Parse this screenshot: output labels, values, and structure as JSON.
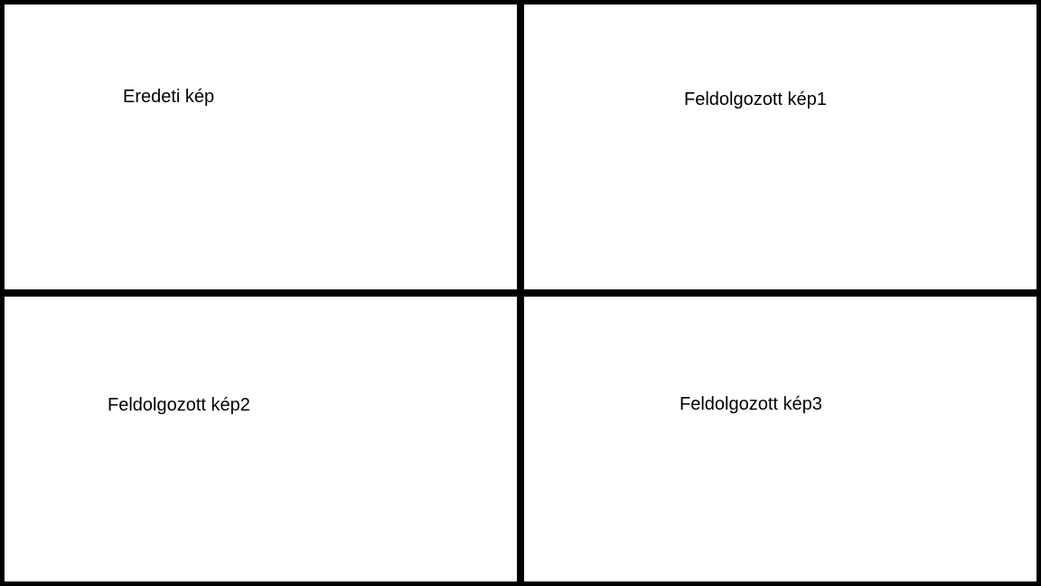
{
  "panels": {
    "original": {
      "label": "Eredeti kép"
    },
    "processed1": {
      "label": "Feldolgozott kép1"
    },
    "processed2": {
      "label": "Feldolgozott kép2"
    },
    "processed3": {
      "label": "Feldolgozott kép3"
    }
  },
  "colors": {
    "background": "#000000",
    "panel": "#ffffff",
    "text": "#000000"
  }
}
